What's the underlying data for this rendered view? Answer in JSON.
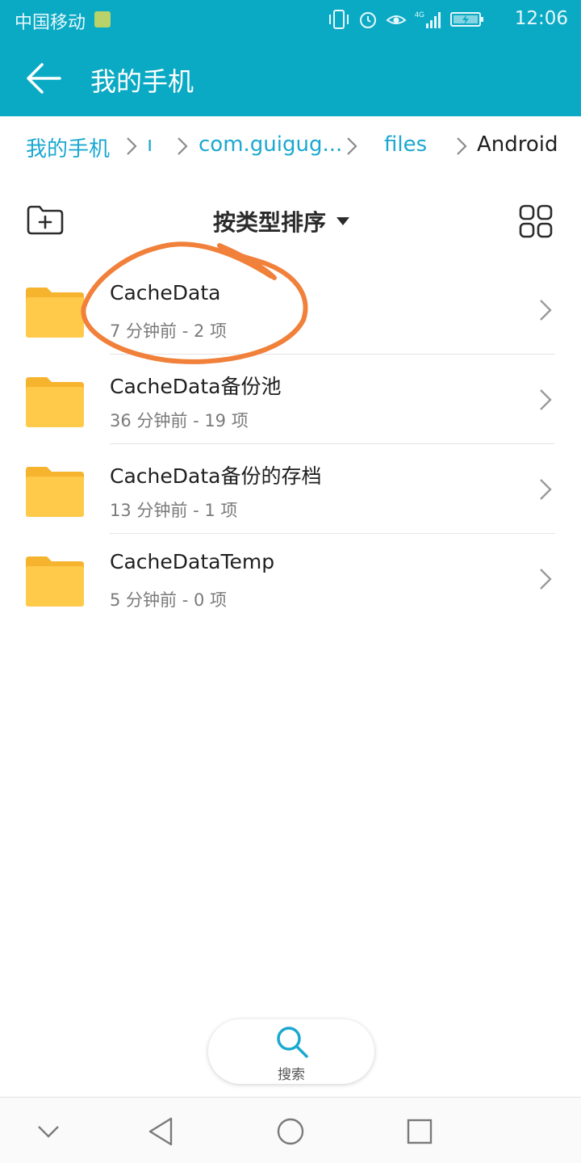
{
  "status_bar": {
    "carrier": "中国移动",
    "network": "4G",
    "time": "12:06",
    "icons": [
      "vibrate-icon",
      "alarm-icon",
      "eye-comfort-icon",
      "signal-icon",
      "battery-charging-icon"
    ]
  },
  "app_bar": {
    "title": "我的手机",
    "back_icon": "back-arrow-icon",
    "color": "#0aaac5"
  },
  "breadcrumb": {
    "items": [
      {
        "label": "我的手机"
      },
      {
        "label": "ı"
      },
      {
        "label": "com.guigug..."
      },
      {
        "label": "files"
      },
      {
        "label": "Android"
      }
    ],
    "link_color": "#1ba8d0"
  },
  "toolbar": {
    "sort_label": "按类型排序",
    "new_folder_icon": "new-folder-icon",
    "view_icon": "grid-view-icon"
  },
  "files": [
    {
      "name": "CacheData",
      "meta": "7 分钟前 - 2 项"
    },
    {
      "name": "CacheData备份池",
      "meta": "36 分钟前 - 19 项"
    },
    {
      "name": "CacheData备份的存档",
      "meta": "13 分钟前 - 1 项"
    },
    {
      "name": "CacheDataTemp",
      "meta": "5 分钟前 - 0 项"
    }
  ],
  "search": {
    "label": "搜索"
  },
  "annotation_color": "#f0803a",
  "folder_color": "#ffc94a"
}
